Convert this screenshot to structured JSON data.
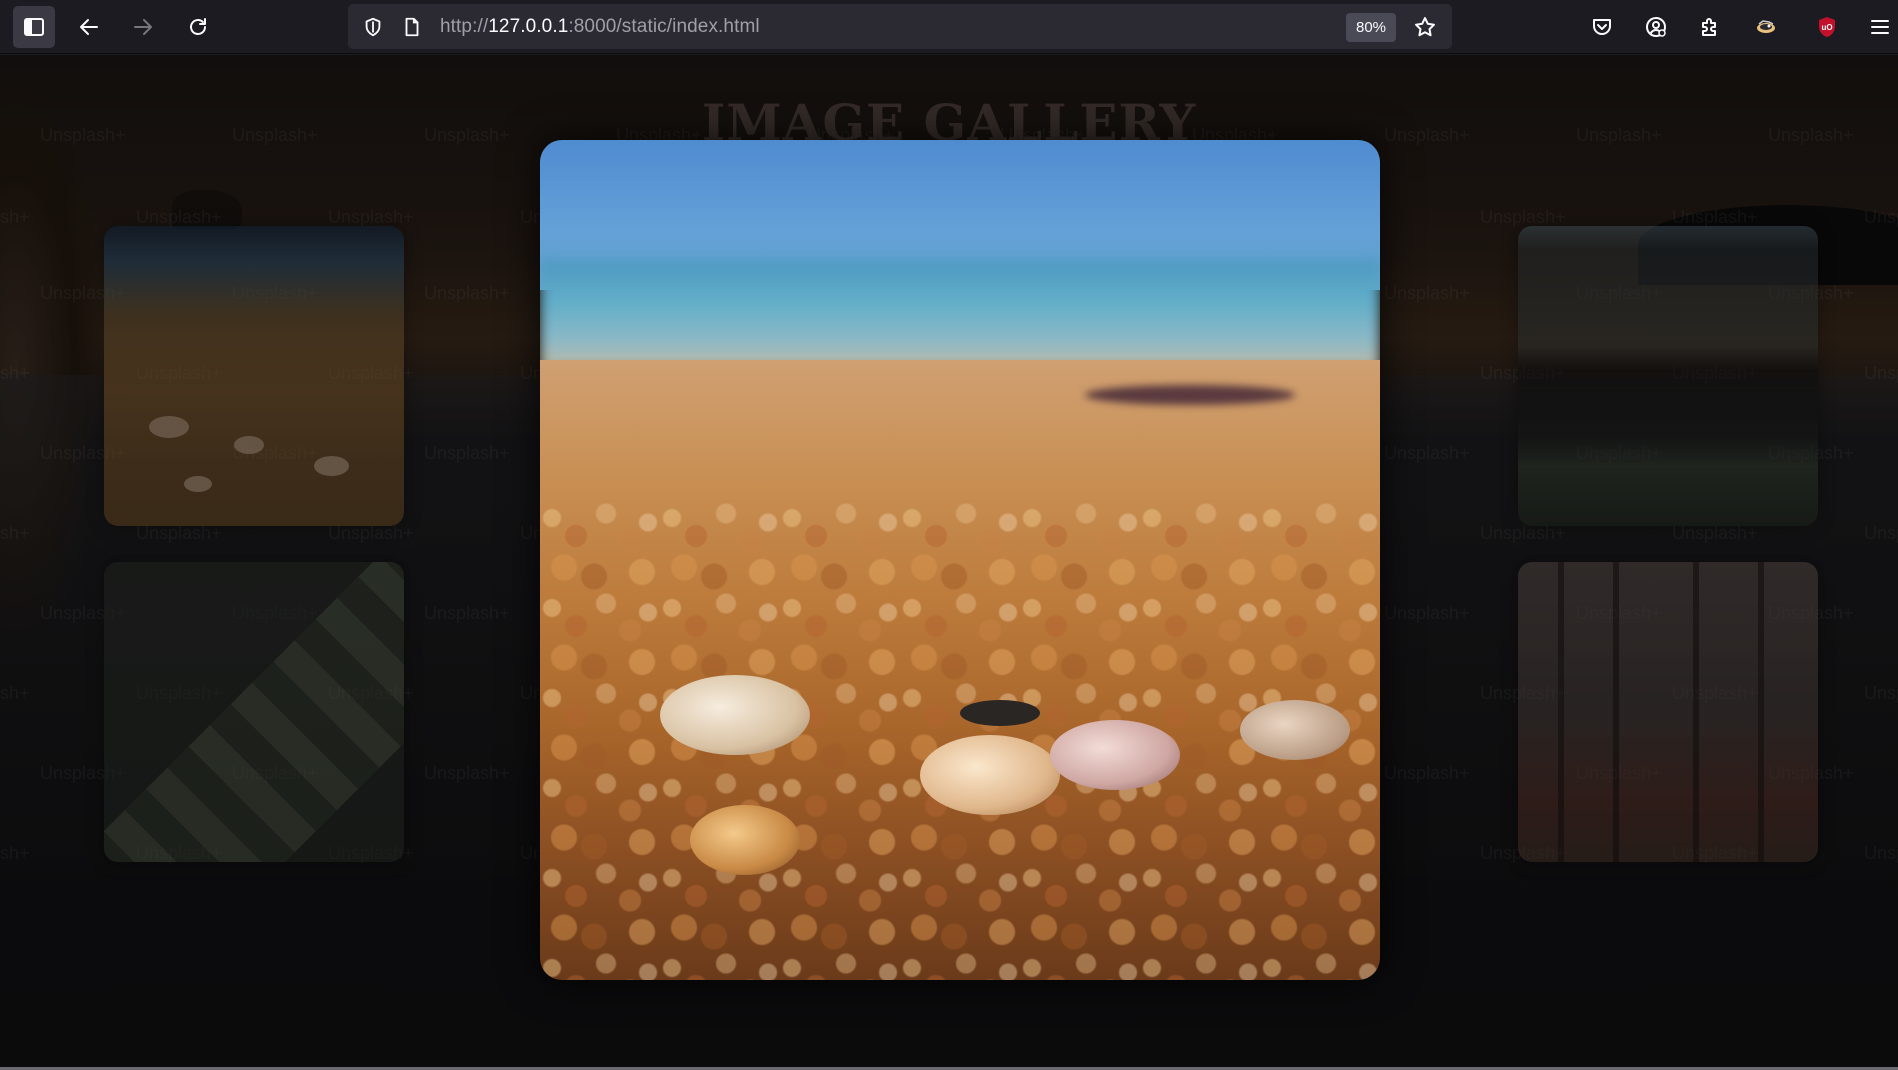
{
  "browser": {
    "url_prefix": "http://",
    "url_host": "127.0.0.1",
    "url_rest": ":8000/static/index.html",
    "zoom": "80%",
    "icons": {
      "sidebar": "sidebar-icon",
      "back": "arrow-left-icon",
      "forward": "arrow-right-icon",
      "reload": "reload-icon",
      "shield": "shield-icon",
      "page": "page-icon",
      "bookmark": "star-icon",
      "pocket": "pocket-icon",
      "account": "account-icon",
      "extensions": "puzzle-icon",
      "extension_bird": "extension-icon",
      "ublock": "ublock-icon",
      "menu": "hamburger-menu-icon"
    }
  },
  "page": {
    "title": "IMAGE GALLERY",
    "watermark": "Unsplash+",
    "gallery": [
      {
        "name": "shells-thumbnail",
        "subject": "beach shells"
      },
      {
        "name": "field-thumbnail",
        "subject": "misty field"
      },
      {
        "name": "architecture-thumbnail",
        "subject": "building facade"
      },
      {
        "name": "forest-thumbnail",
        "subject": "foggy forest"
      }
    ],
    "lightbox": {
      "subject": "beach shells close-up"
    }
  },
  "colors": {
    "chrome_bg": "#1c1b22",
    "urlbar_bg": "#2b2a33",
    "ublock_red": "#c4112b"
  }
}
